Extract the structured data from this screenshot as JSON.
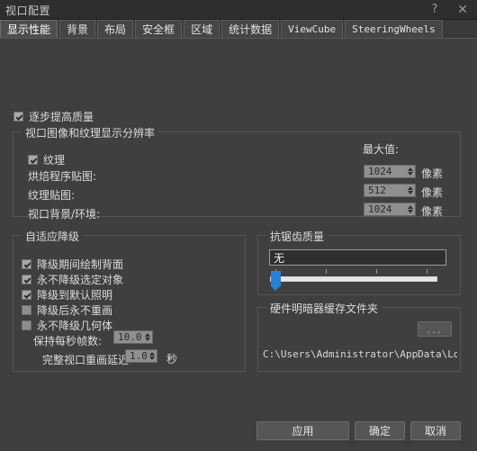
{
  "window": {
    "title": "视口配置",
    "help_icon": "?",
    "close_icon": "✕"
  },
  "tabs": [
    {
      "label": "显示性能",
      "active": true
    },
    {
      "label": "背景",
      "active": false
    },
    {
      "label": "布局",
      "active": false
    },
    {
      "label": "安全框",
      "active": false
    },
    {
      "label": "区域",
      "active": false
    },
    {
      "label": "统计数据",
      "active": false
    },
    {
      "label": "ViewCube",
      "active": false
    },
    {
      "label": "SteeringWheels",
      "active": false
    }
  ],
  "main": {
    "progressive_quality": {
      "label": "逐步提高质量",
      "checked": true
    },
    "resolution_group": {
      "title": "视口图像和纹理显示分辨率",
      "max_label": "最大值:",
      "texture_checkbox": {
        "label": "纹理",
        "checked": true
      },
      "rows": [
        {
          "label": "烘焙程序贴图:",
          "value": "1024",
          "unit": "像素"
        },
        {
          "label": "纹理贴图:",
          "value": "512",
          "unit": "像素"
        },
        {
          "label": "视口背景/环境:",
          "value": "1024",
          "unit": "像素"
        }
      ]
    },
    "adaptive_group": {
      "title": "自适应降级",
      "checkboxes": [
        {
          "label": "降级期间绘制背面",
          "checked": true
        },
        {
          "label": "永不降级选定对象",
          "checked": true
        },
        {
          "label": "降级到默认照明",
          "checked": true
        },
        {
          "label": "降级后永不重画",
          "checked": false
        },
        {
          "label": "永不降级几何体",
          "checked": false
        }
      ],
      "fps_row": {
        "label": "保持每秒帧数:",
        "value": "10.0"
      },
      "delay_row": {
        "label": "完整视口重画延迟",
        "value": "1.0",
        "unit": "秒"
      }
    },
    "antialias_group": {
      "title": "抗锯齿质量",
      "value": "无",
      "slider": {
        "position_percent": 0,
        "tick_count": 4
      }
    },
    "cache_group": {
      "title": "硬件明暗器缓存文件夹",
      "browse_label": "...",
      "path": "C:\\Users\\Administrator\\AppData\\Local\\A"
    }
  },
  "footer": {
    "apply": "应用",
    "ok": "确定",
    "cancel": "取消"
  }
}
